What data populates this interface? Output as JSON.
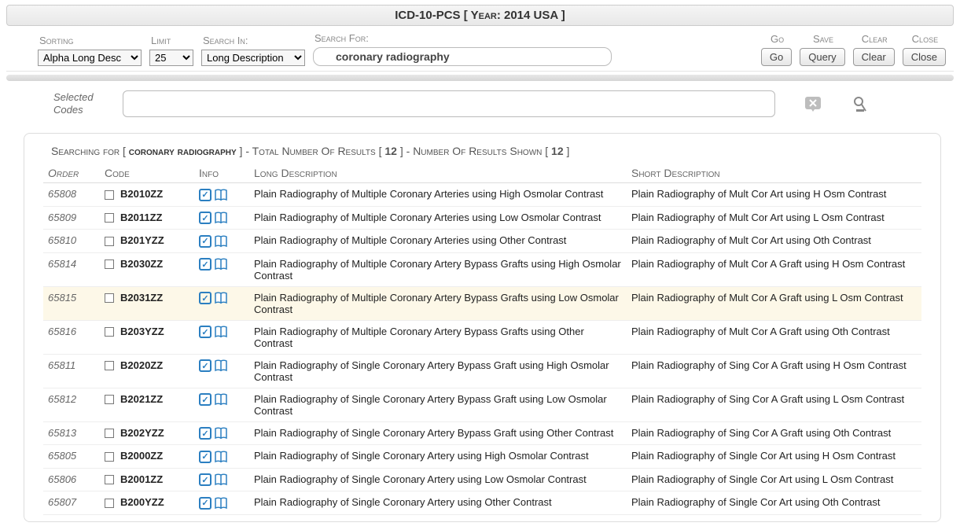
{
  "title": "ICD-10-PCS [ Year: 2014 USA ]",
  "toolbar": {
    "sorting_label": "Sorting",
    "sorting_value": "Alpha Long Desc",
    "limit_label": "Limit",
    "limit_value": "25",
    "search_in_label": "Search In:",
    "search_in_value": "Long Description",
    "search_for_label": "Search For:",
    "search_value": "coronary radiography",
    "go_label": "Go",
    "go_btn": "Go",
    "save_label": "Save",
    "save_btn": "Query",
    "clear_label": "Clear",
    "clear_btn": "Clear",
    "close_label": "Close",
    "close_btn": "Close"
  },
  "selected": {
    "label": "Selected Codes",
    "value": ""
  },
  "summary": {
    "prefix": "Searching for [ ",
    "term": "coronary radiography",
    "mid1": " ] - Total Number Of Results [ ",
    "total": "12",
    "mid2": " ] - Number Of Results Shown [ ",
    "shown": "12",
    "suffix": " ]"
  },
  "columns": {
    "order": "Order",
    "code": "Code",
    "info": "Info",
    "long": "Long Description",
    "short": "Short Description"
  },
  "rows": [
    {
      "order": "65808",
      "code": "B2010ZZ",
      "long": "Plain Radiography of Multiple Coronary Arteries using High Osmolar Contrast",
      "short": "Plain Radiography of Mult Cor Art using H Osm Contrast",
      "hl": false
    },
    {
      "order": "65809",
      "code": "B2011ZZ",
      "long": "Plain Radiography of Multiple Coronary Arteries using Low Osmolar Contrast",
      "short": "Plain Radiography of Mult Cor Art using L Osm Contrast",
      "hl": false
    },
    {
      "order": "65810",
      "code": "B201YZZ",
      "long": "Plain Radiography of Multiple Coronary Arteries using Other Contrast",
      "short": "Plain Radiography of Mult Cor Art using Oth Contrast",
      "hl": false
    },
    {
      "order": "65814",
      "code": "B2030ZZ",
      "long": "Plain Radiography of Multiple Coronary Artery Bypass Grafts using High Osmolar Contrast",
      "short": "Plain Radiography of Mult Cor A Graft using H Osm Contrast",
      "hl": false
    },
    {
      "order": "65815",
      "code": "B2031ZZ",
      "long": "Plain Radiography of Multiple Coronary Artery Bypass Grafts using Low Osmolar Contrast",
      "short": "Plain Radiography of Mult Cor A Graft using L Osm Contrast",
      "hl": true
    },
    {
      "order": "65816",
      "code": "B203YZZ",
      "long": "Plain Radiography of Multiple Coronary Artery Bypass Grafts using Other Contrast",
      "short": "Plain Radiography of Mult Cor A Graft using Oth Contrast",
      "hl": false
    },
    {
      "order": "65811",
      "code": "B2020ZZ",
      "long": "Plain Radiography of Single Coronary Artery Bypass Graft using High Osmolar Contrast",
      "short": "Plain Radiography of Sing Cor A Graft using H Osm Contrast",
      "hl": false
    },
    {
      "order": "65812",
      "code": "B2021ZZ",
      "long": "Plain Radiography of Single Coronary Artery Bypass Graft using Low Osmolar Contrast",
      "short": "Plain Radiography of Sing Cor A Graft using L Osm Contrast",
      "hl": false
    },
    {
      "order": "65813",
      "code": "B202YZZ",
      "long": "Plain Radiography of Single Coronary Artery Bypass Graft using Other Contrast",
      "short": "Plain Radiography of Sing Cor A Graft using Oth Contrast",
      "hl": false
    },
    {
      "order": "65805",
      "code": "B2000ZZ",
      "long": "Plain Radiography of Single Coronary Artery using High Osmolar Contrast",
      "short": "Plain Radiography of Single Cor Art using H Osm Contrast",
      "hl": false
    },
    {
      "order": "65806",
      "code": "B2001ZZ",
      "long": "Plain Radiography of Single Coronary Artery using Low Osmolar Contrast",
      "short": "Plain Radiography of Single Cor Art using L Osm Contrast",
      "hl": false
    },
    {
      "order": "65807",
      "code": "B200YZZ",
      "long": "Plain Radiography of Single Coronary Artery using Other Contrast",
      "short": "Plain Radiography of Single Cor Art using Oth Contrast",
      "hl": false
    }
  ]
}
